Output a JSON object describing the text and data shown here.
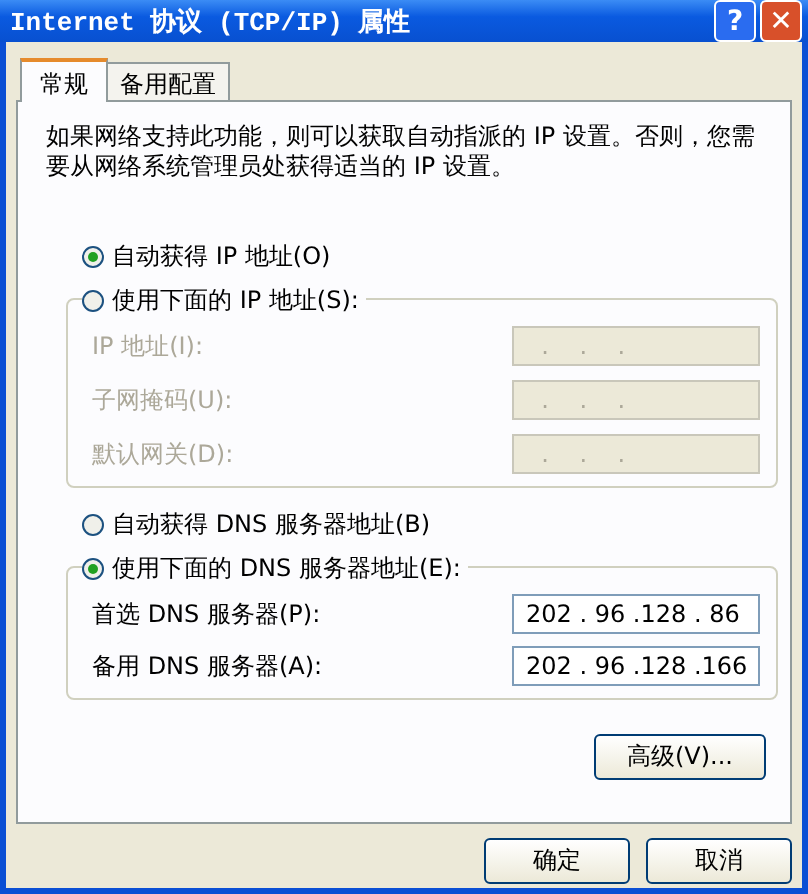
{
  "window": {
    "title": "Internet 协议 (TCP/IP) 属性",
    "buttons": [
      {
        "kind": "help",
        "label": "?"
      },
      {
        "kind": "close",
        "label": "✕"
      }
    ]
  },
  "tabs": [
    {
      "label": "常规",
      "selected": true
    },
    {
      "label": "备用配置",
      "selected": false
    }
  ],
  "description": "如果网络支持此功能，则可以获取自动指派的 IP 设置。否则，您需要从网络系统管理员处获得适当的 IP 设置。",
  "ip_options": [
    {
      "label": "自动获得 IP 地址(O)",
      "selected": true
    },
    {
      "label": "使用下面的 IP 地址(S):",
      "selected": false
    }
  ],
  "ip_fields": [
    {
      "label": "IP 地址(I):",
      "value": "  .    .    .",
      "disabled": true
    },
    {
      "label": "子网掩码(U):",
      "value": "  .    .    .",
      "disabled": true
    },
    {
      "label": "默认网关(D):",
      "value": "  .    .    .",
      "disabled": true
    }
  ],
  "dns_options": [
    {
      "label": "自动获得 DNS 服务器地址(B)",
      "selected": false
    },
    {
      "label": "使用下面的 DNS 服务器地址(E):",
      "selected": true
    }
  ],
  "dns_fields": [
    {
      "label": "首选 DNS 服务器(P):",
      "value": "202 . 96 .128 . 86",
      "disabled": false
    },
    {
      "label": "备用 DNS 服务器(A):",
      "value": "202 . 96 .128 .166",
      "disabled": false
    }
  ],
  "advanced_button": "高级(V)...",
  "buttons": [
    "确定",
    "取消"
  ]
}
